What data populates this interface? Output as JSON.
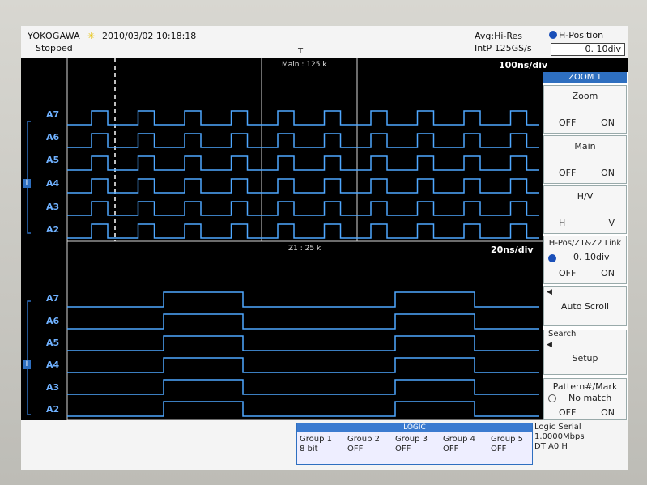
{
  "header": {
    "brand": "YOKOGAWA",
    "datetime": "2010/03/02 10:18:18",
    "status": "Stopped",
    "acq_mode": "Avg:Hi-Res",
    "sample_rate": "IntP  125GS/s",
    "hposition_label": "H-Position",
    "hposition_value": "0. 10div"
  },
  "main_window": {
    "label": "Main : 125 k",
    "timebase": "100ns/div",
    "channels": [
      "A7",
      "A6",
      "A5",
      "A4",
      "A3",
      "A2"
    ]
  },
  "zoom_window": {
    "label": "Z1 : 25 k",
    "timebase": "20ns/div",
    "channels": [
      "A7",
      "A6",
      "A5",
      "A4",
      "A3",
      "A2"
    ]
  },
  "softkeys": {
    "menu_title": "ZOOM 1",
    "zoom": {
      "label": "Zoom",
      "off": "OFF",
      "on": "ON"
    },
    "main": {
      "label": "Main",
      "off": "OFF",
      "on": "ON"
    },
    "hv": {
      "label": "H/V",
      "h": "H",
      "v": "V"
    },
    "hpos_link": {
      "label": "H-Pos/Z1&Z2 Link",
      "value": "0. 10div",
      "off": "OFF",
      "on": "ON"
    },
    "auto_scroll": {
      "label": "Auto Scroll"
    },
    "search": {
      "section": "Search",
      "label": "Setup"
    },
    "pattern": {
      "label": "Pattern#/Mark",
      "value": "No match",
      "off": "OFF",
      "on": "ON"
    }
  },
  "logic_panel": {
    "title": "LOGIC",
    "groups": [
      {
        "name": "Group 1",
        "value": "8 bit"
      },
      {
        "name": "Group 2",
        "value": "OFF"
      },
      {
        "name": "Group 3",
        "value": "OFF"
      },
      {
        "name": "Group 4",
        "value": "OFF"
      },
      {
        "name": "Group 5",
        "value": "OFF"
      }
    ]
  },
  "logic_serial": {
    "label": "Logic Serial",
    "bitrate": "1.0000Mbps",
    "dt": "DT A0 H"
  },
  "colors": {
    "trace": "#4fa8ff",
    "grid": "#ffffff",
    "background": "#000000",
    "accent": "#2e6fc0"
  }
}
